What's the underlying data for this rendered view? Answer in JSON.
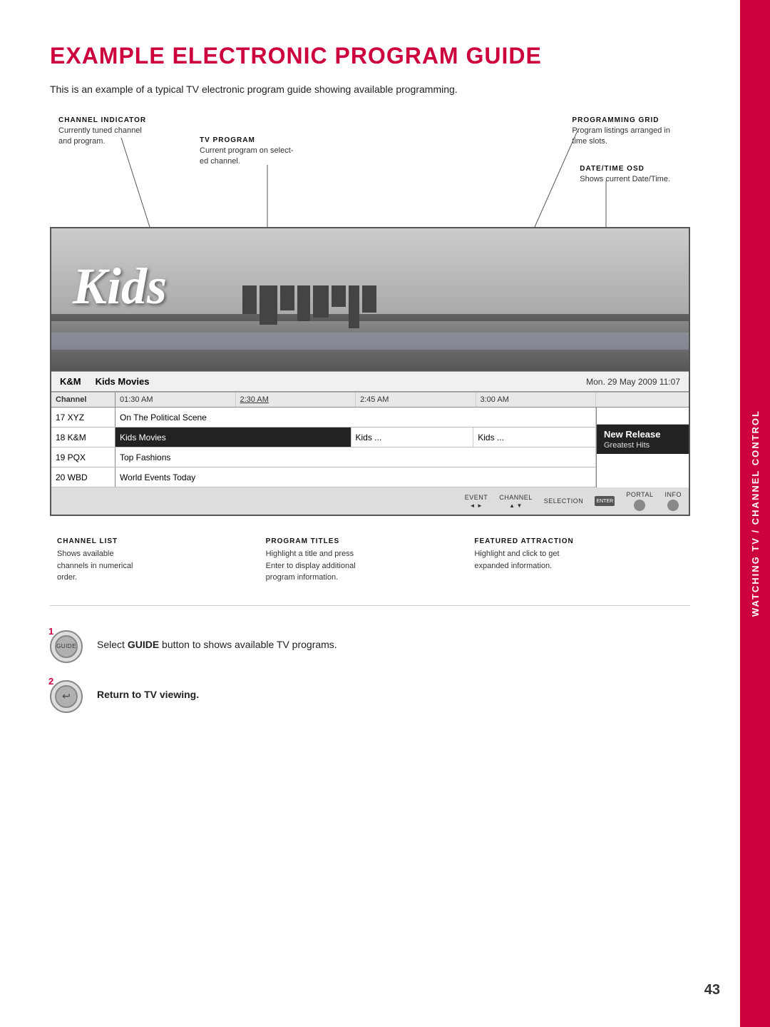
{
  "page": {
    "title": "EXAMPLE ELECTRONIC PROGRAM GUIDE",
    "subtitle": "This is an example of a typical TV electronic program guide showing available programming.",
    "page_number": "43",
    "side_tab": "WATCHING TV / CHANNEL CONTROL"
  },
  "annotations": {
    "channel_indicator": {
      "label": "CHANNEL INDICATOR",
      "desc": "Currently tuned channel\nand program."
    },
    "tv_program": {
      "label": "TV PROGRAM",
      "desc": "Current program on select-\ned channel."
    },
    "programming_grid": {
      "label": "PROGRAMMING GRID",
      "desc": "Program listings arranged in\ntime slots."
    },
    "date_time_osd": {
      "label": "DATE/TIME OSD",
      "desc": "Shows current Date/Time."
    }
  },
  "epg": {
    "video_text": "Kids",
    "channel_bar": {
      "channel_id": "K&M",
      "program": "Kids Movies",
      "datetime": "Mon. 29 May 2009 11:07"
    },
    "grid": {
      "times": [
        "Channel",
        "01:30 AM",
        "2:30 AM",
        "2:45 AM",
        "3:00 AM"
      ],
      "rows": [
        {
          "channel": "17 XYZ",
          "programs": [
            {
              "title": "On The Political Scene",
              "span": "wide"
            }
          ]
        },
        {
          "channel": "18 K&M",
          "programs": [
            {
              "title": "Kids Movies",
              "span": "wide",
              "highlighted": true
            },
            {
              "title": "Kids ...",
              "span": "medium"
            },
            {
              "title": "Kids ...",
              "span": "medium"
            }
          ]
        },
        {
          "channel": "19 PQX",
          "programs": [
            {
              "title": "Top Fashions",
              "span": "wide"
            }
          ]
        },
        {
          "channel": "20 WBD",
          "programs": [
            {
              "title": "World Events Today",
              "span": "wide"
            }
          ]
        }
      ],
      "featured": {
        "title": "New Release",
        "subtitle": "Greatest Hits"
      }
    },
    "controls": [
      {
        "label": "EVENT",
        "buttons": "◄ ►"
      },
      {
        "label": "CHANNEL",
        "buttons": "▲ ▼"
      },
      {
        "label": "SELECTION",
        "buttons": ""
      },
      {
        "label": "PORTAL",
        "buttons": ""
      },
      {
        "label": "INFO",
        "buttons": ""
      }
    ],
    "enter_label": "ENTER"
  },
  "below_annotations": {
    "channel_list": {
      "label": "CHANNEL LIST",
      "desc": "Shows available\nchannels in numerical\norder."
    },
    "program_titles": {
      "label": "PROGRAM TITLES",
      "desc": "Highlight a title and press\nEnter to display additional\nprogram information."
    },
    "featured_attraction": {
      "label": "FEATURED ATTRACTION",
      "desc": "Highlight and click to get\nexpanded information."
    }
  },
  "steps": [
    {
      "number": "1",
      "button_label": "GUIDE",
      "desc_prefix": "Select ",
      "desc_bold": "GUIDE",
      "desc_suffix": " button to shows available TV programs."
    },
    {
      "number": "2",
      "button_label": "RETURN",
      "desc_prefix": "",
      "desc_bold": "Return to TV viewing.",
      "desc_suffix": ""
    }
  ]
}
